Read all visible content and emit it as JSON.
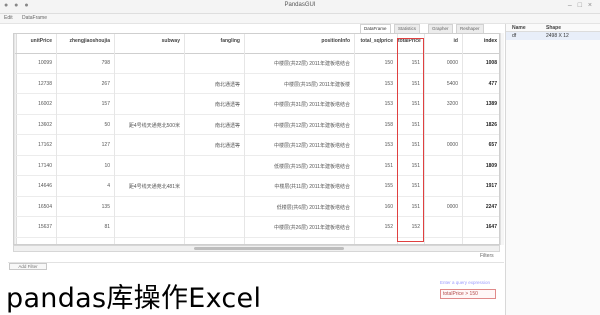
{
  "window": {
    "title": "PandasGUI",
    "menu": [
      "Edit",
      "DataFrame"
    ]
  },
  "tabs": [
    {
      "label": "DataFrame",
      "active": true
    },
    {
      "label": "Statistics",
      "active": false
    },
    {
      "label": "Grapher",
      "active": false
    },
    {
      "label": "Reshaper",
      "active": false
    }
  ],
  "table": {
    "columns": [
      "index",
      "id",
      "totalPrice",
      "total_sqlprice",
      "positionInfo",
      "fangling",
      "subway",
      "zhengjiaoshoujia",
      "unitPrice"
    ],
    "rows": [
      [
        "1008",
        "0000",
        "151",
        "150",
        "中楼层(共22层) 2011年建板塔结合",
        "",
        "",
        "798",
        "10099"
      ],
      [
        "477",
        "5400",
        "151",
        "153",
        "中楼层(共15层) 2011年建板楼",
        "南北通透等",
        "",
        "267",
        "12738"
      ],
      [
        "1389",
        "3200",
        "151",
        "153",
        "中楼层(共31层) 2011年建板塔结合",
        "南北通透等",
        "",
        "157",
        "16002"
      ],
      [
        "1826",
        "",
        "151",
        "158",
        "中楼层(共12层) 2011年建板塔结合",
        "南北通透等",
        "距4号线天通苑北500米",
        "50",
        "13602"
      ],
      [
        "657",
        "0000",
        "151",
        "153",
        "中楼层(共12层) 2011年建板塔结合",
        "南北通透等",
        "",
        "127",
        "17162"
      ],
      [
        "1809",
        "",
        "151",
        "151",
        "低楼层(共15层) 2011年建板塔结合",
        "",
        "",
        "10",
        "17140"
      ],
      [
        "1917",
        "",
        "151",
        "155",
        "中楼层(共11层) 2011年建板塔结合",
        "",
        "距4号线天通苑北481米",
        "4",
        "14646"
      ],
      [
        "2247",
        "0000",
        "151",
        "160",
        "低楼层(共6层) 2011年建板塔结合",
        "",
        "",
        "135",
        "16504"
      ],
      [
        "1647",
        "",
        "152",
        "152",
        "中楼层(共26层) 2011年建板塔结合",
        "",
        "",
        "81",
        "15637"
      ]
    ]
  },
  "filters": {
    "label": "Filters",
    "button_label": "Add Filter",
    "hint": "Enter a query expression",
    "active_filter": "totalPrice > 150"
  },
  "side_panel": {
    "headers": [
      "Name",
      "Shape"
    ],
    "rows": [
      {
        "name": "df",
        "shape": "2498 X 12"
      }
    ]
  },
  "caption": "pandas库操作Excel",
  "colors": {
    "highlight": "#e04040",
    "filter_border": "#e08a8a"
  }
}
